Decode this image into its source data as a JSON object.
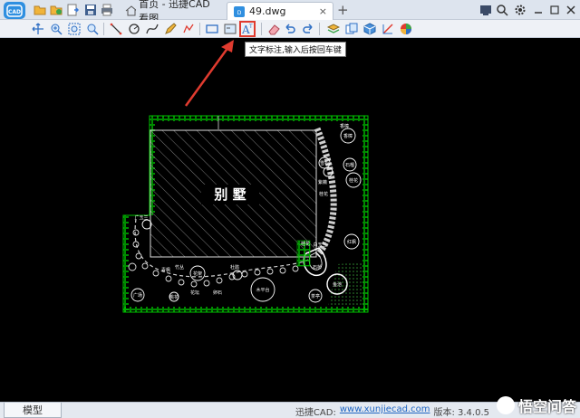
{
  "titlebar": {
    "tabs": [
      {
        "label": "首页 - 迅捷CAD看图"
      },
      {
        "label": "49.dwg"
      }
    ],
    "close_glyph": "×",
    "new_tab_glyph": "+"
  },
  "tooltip": {
    "text": "文字标注,输入后按回车键"
  },
  "drawing": {
    "main_label": "别 墅",
    "small_labels": [
      "香樟",
      "香樟",
      "雪松",
      "石榴",
      "紫薇",
      "桂花",
      "广玉兰",
      "桂花",
      "白玉兰",
      "桂花",
      "石桥",
      "花架",
      "木平台",
      "茶亭",
      "广场",
      "青枫",
      "竹丛",
      "杜鹃",
      "红枫",
      "桃花",
      "鱼池",
      "卵石",
      "花坛"
    ]
  },
  "statusbar": {
    "model_tab": "模型",
    "brand_label": "迅捷CAD:",
    "url": "www.xunjiecad.com",
    "version": "版本: 3.4.0.5"
  },
  "watermark": {
    "text": "悟空问答"
  },
  "colors": {
    "accent": "#2f8fe0",
    "cad_background": "#000000",
    "cad_green": "#00c400",
    "annotation_red": "#e03b2f"
  }
}
